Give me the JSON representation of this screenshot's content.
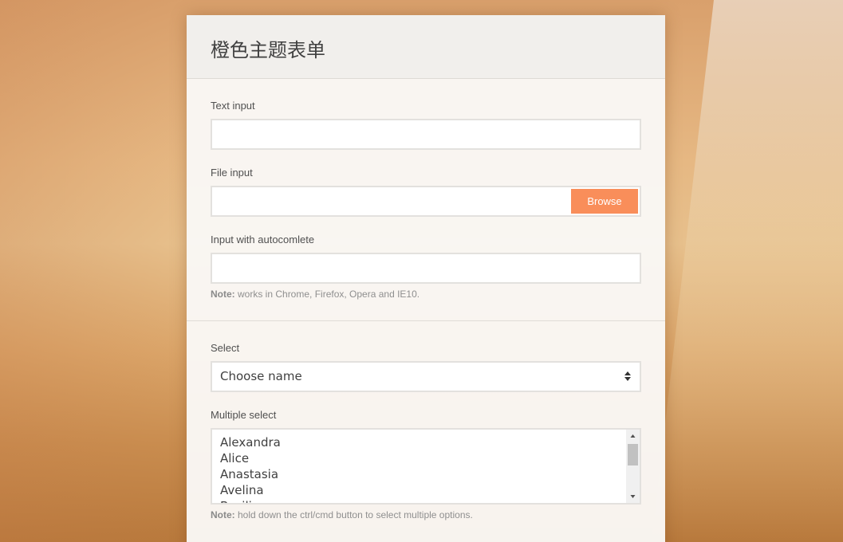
{
  "form": {
    "title": "橙色主题表单",
    "text_input": {
      "label": "Text input",
      "value": ""
    },
    "file_input": {
      "label": "File input",
      "value": "",
      "button_label": "Browse"
    },
    "autocomplete": {
      "label": "Input with autocomlete",
      "value": "",
      "note_bold": "Note:",
      "note_text": " works in Chrome, Firefox, Opera and IE10."
    },
    "select": {
      "label": "Select",
      "selected": "Choose name"
    },
    "multi_select": {
      "label": "Multiple select",
      "options": [
        "Alexandra",
        "Alice",
        "Anastasia",
        "Avelina",
        "Basilia"
      ],
      "note_bold": "Note:",
      "note_text": " hold down the ctrl/cmd button to select multiple options."
    }
  },
  "colors": {
    "accent": "#f98e5a",
    "background": "#e6b883",
    "card": "#f9f7f5"
  },
  "icons": {
    "select_arrows": "up-down-arrows-icon",
    "scroll_up": "triangle-up-icon",
    "scroll_down": "triangle-down-icon"
  }
}
